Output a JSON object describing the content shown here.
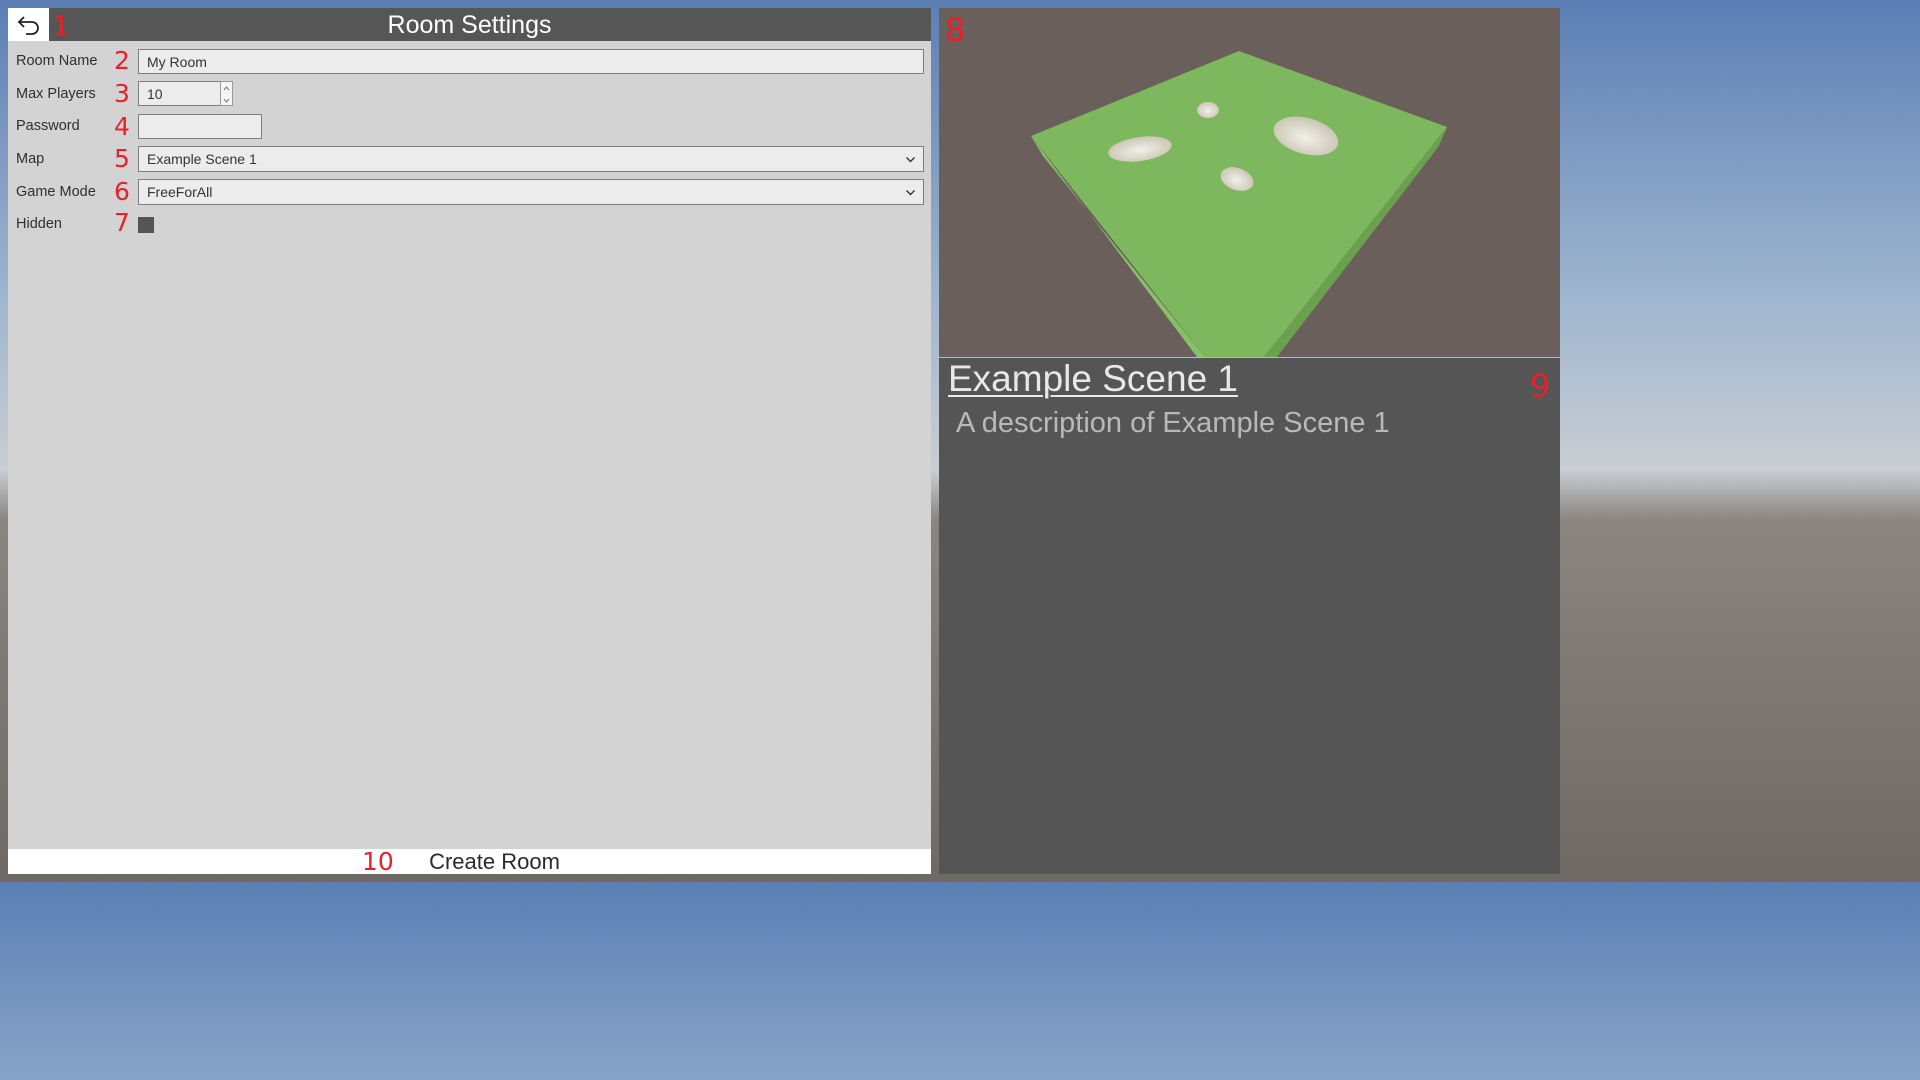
{
  "header": {
    "title": "Room Settings",
    "back_icon": "undo-arrow-icon"
  },
  "annotations": [
    "1",
    "2",
    "3",
    "4",
    "5",
    "6",
    "7",
    "8",
    "9",
    "10"
  ],
  "form": {
    "room_name": {
      "label": "Room Name",
      "value": "My Room"
    },
    "max_players": {
      "label": "Max Players",
      "value": "10"
    },
    "password": {
      "label": "Password",
      "value": ""
    },
    "map": {
      "label": "Map",
      "value": "Example Scene 1"
    },
    "game_mode": {
      "label": "Game Mode",
      "value": "FreeForAll"
    },
    "hidden": {
      "label": "Hidden",
      "checked": false
    }
  },
  "create_button": {
    "label": "Create Room"
  },
  "map_info": {
    "title": "Example Scene 1",
    "description": "A description of Example Scene 1"
  },
  "colors": {
    "panel": "#d3d3d3",
    "title_bar": "#565656",
    "annotation": "#e8202a",
    "info_panel": "#555555",
    "terrain": "#7db85f"
  }
}
